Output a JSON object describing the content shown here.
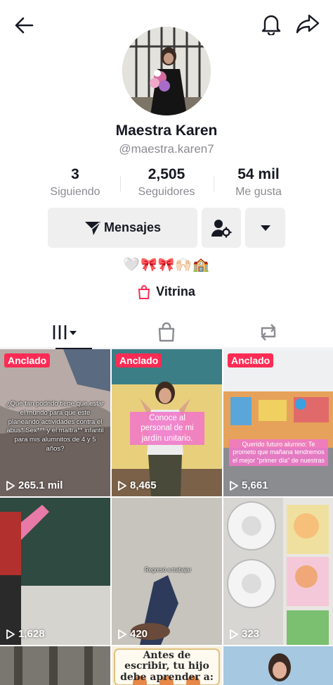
{
  "profile": {
    "name": "Maestra Karen",
    "handle": "@maestra.karen7",
    "bio_emojis": "🤍🎀🎀🙌🏻🏫"
  },
  "stats": [
    {
      "value": "3",
      "label": "Siguiendo"
    },
    {
      "value": "2,505",
      "label": "Seguidores"
    },
    {
      "value": "54 mil",
      "label": "Me gusta"
    }
  ],
  "actions": {
    "message_label": "Mensajes"
  },
  "vitrina": {
    "label": "Vitrina"
  },
  "tabs": [
    {
      "icon": "grid-videos-icon",
      "active": true
    },
    {
      "icon": "shopping-bag-icon",
      "active": false
    },
    {
      "icon": "repost-icon",
      "active": false
    }
  ],
  "videos": [
    {
      "pinned_label": "Anclado",
      "views": "265.1 mil",
      "overlay": "¿Qué tan podrido tiene que estar el mundo para que este planeando actividades contra el abus* Sex*** y el maltra** infantil para mis alumnitos de 4 y 5 años?"
    },
    {
      "pinned_label": "Anclado",
      "views": "8,465",
      "overlay": "Conoce al personal de mi jardín unitario."
    },
    {
      "pinned_label": "Anclado",
      "views": "5,661",
      "overlay": "Querido futuro alumno: Te prometo que mañana tendremos el mejor \"primer día\" de nuestras"
    },
    {
      "pinned_label": "",
      "views": "1,628",
      "overlay": ""
    },
    {
      "pinned_label": "",
      "views": "420",
      "overlay": "Regresó a trabajar"
    },
    {
      "pinned_label": "",
      "views": "323",
      "overlay": ""
    },
    {
      "pinned_label": "",
      "views": "",
      "overlay": ""
    },
    {
      "pinned_label": "",
      "views": "",
      "overlay": "Antes de escribir, tu hijo debe aprender a:"
    },
    {
      "pinned_label": "",
      "views": "",
      "overlay": ""
    }
  ],
  "colors": {
    "accent": "#fe2c55",
    "text": "#161823",
    "muted": "#8a8b91",
    "button_bg": "#efeff0"
  }
}
